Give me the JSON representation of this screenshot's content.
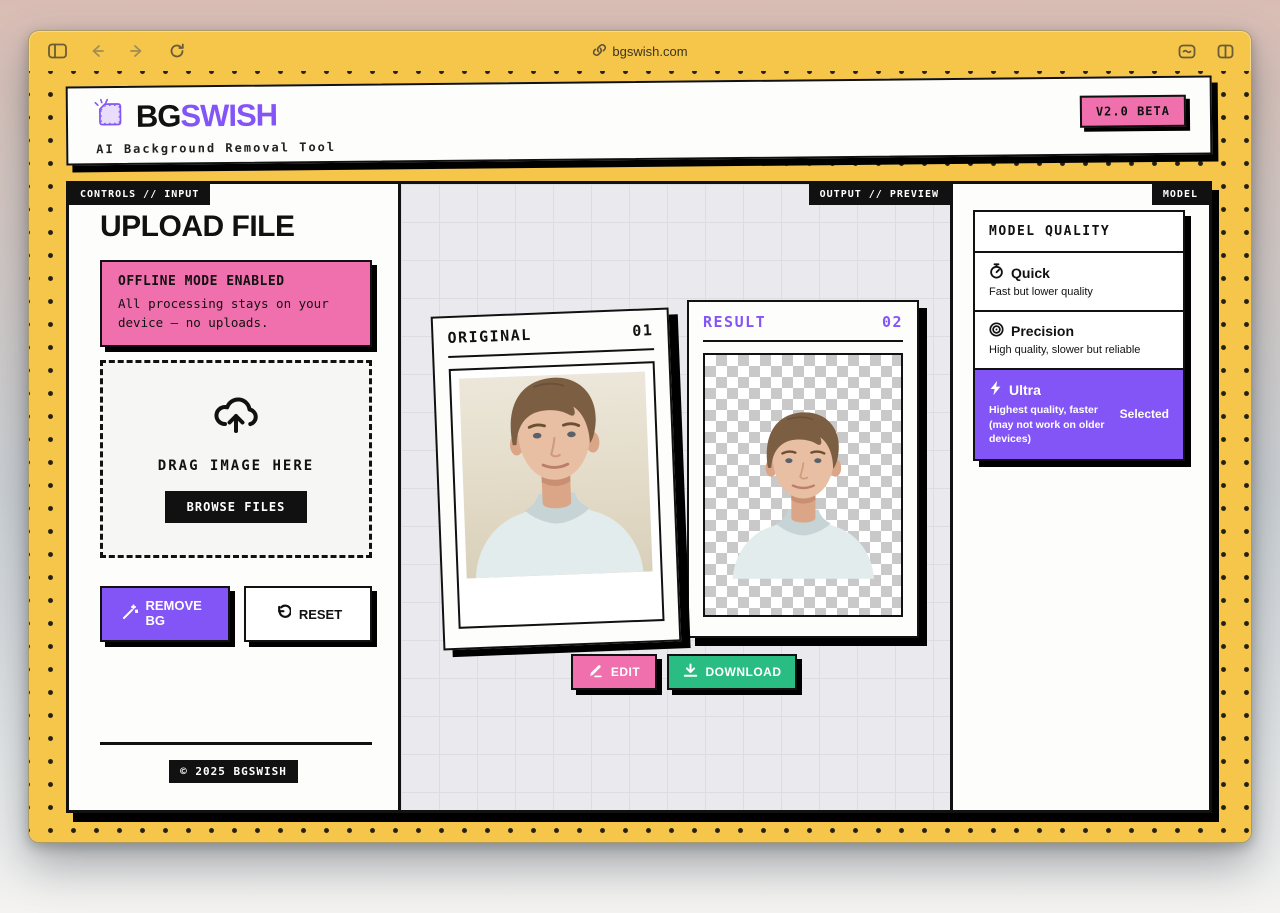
{
  "browser": {
    "url": "bgswish.com"
  },
  "header": {
    "brand_prefix": "BG",
    "brand_suffix": "SWISH",
    "tagline": "AI Background Removal Tool",
    "version_badge": "V2.0 BETA"
  },
  "controls": {
    "tab": "CONTROLS // INPUT",
    "title": "UPLOAD FILE",
    "offline_notice": {
      "title": "OFFLINE MODE ENABLED",
      "body": "All processing stays on your device — no uploads."
    },
    "dropzone": {
      "label": "DRAG IMAGE HERE",
      "browse_button": "BROWSE FILES"
    },
    "remove_bg_button": "REMOVE BG",
    "reset_button": "RESET",
    "copyright": "© 2025 BGSWISH"
  },
  "preview": {
    "tab": "OUTPUT // PREVIEW",
    "original_card": {
      "label": "ORIGINAL",
      "index": "01"
    },
    "result_card": {
      "label": "RESULT",
      "index": "02"
    },
    "edit_button": "EDIT",
    "download_button": "DOWNLOAD"
  },
  "model": {
    "tab": "MODEL",
    "title": "MODEL QUALITY",
    "selected_label": "Selected",
    "options": [
      {
        "name": "Quick",
        "desc": "Fast but lower quality",
        "selected": false
      },
      {
        "name": "Precision",
        "desc": "High quality, slower but reliable",
        "selected": false
      },
      {
        "name": "Ultra",
        "desc": "Highest quality, faster (may not work on older devices)",
        "selected": true
      }
    ]
  },
  "colors": {
    "theme_yellow": "#f6c64b",
    "accent_purple": "#8455f6",
    "accent_pink": "#f06fad",
    "accent_green": "#29bd83",
    "ink": "#111111"
  }
}
